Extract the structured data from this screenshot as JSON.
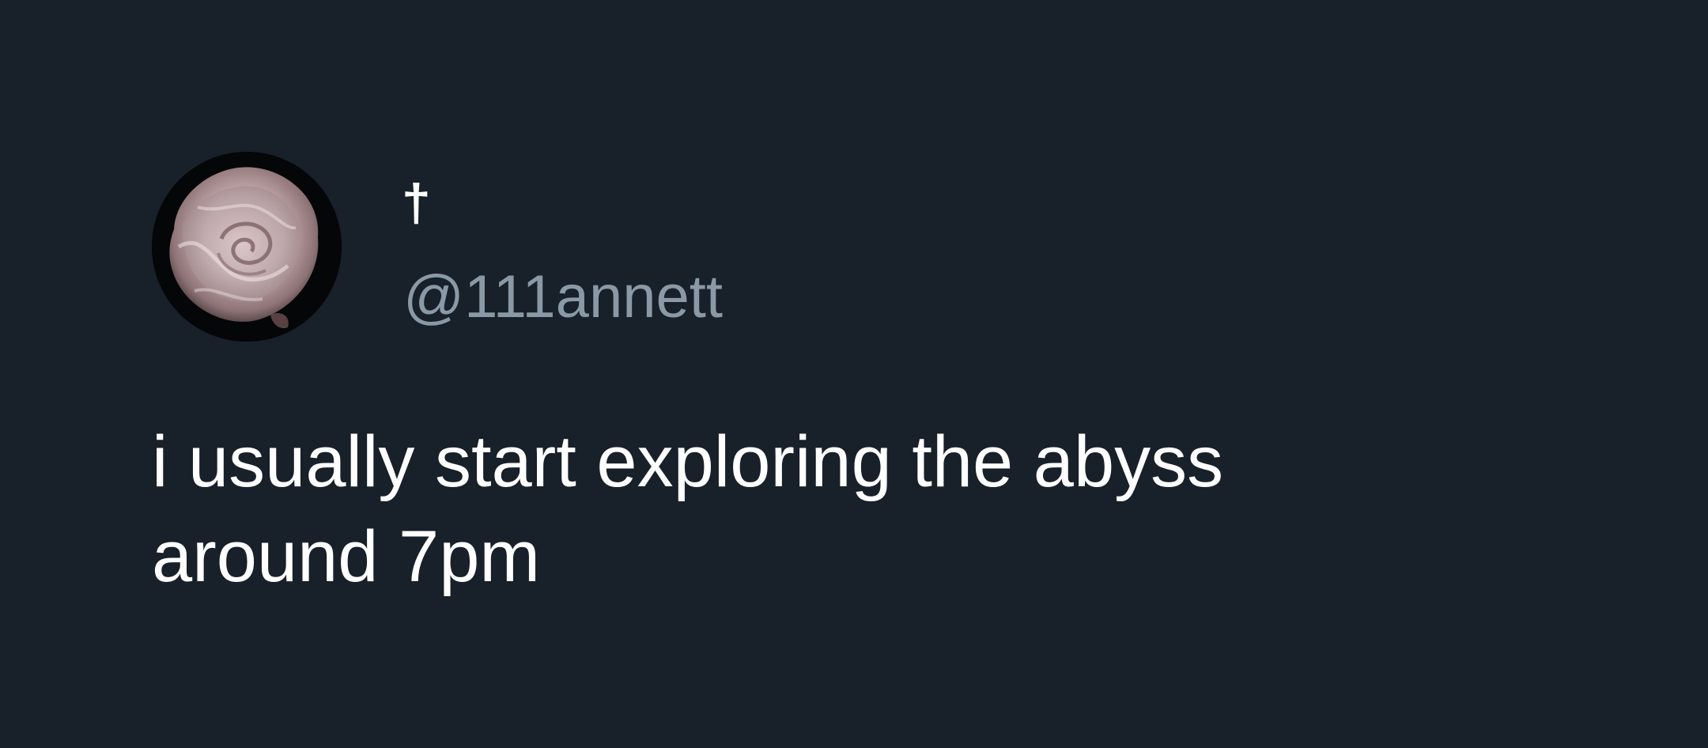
{
  "tweet": {
    "display_name": "†",
    "handle": "@111annett",
    "text_lines": [
      "i usually start exploring the abyss",
      "around 7pm"
    ]
  },
  "avatar": {
    "icon": "rose-photo-icon"
  },
  "colors": {
    "background": "#18202a",
    "text": "#ffffff",
    "handle": "#8a99a6"
  }
}
